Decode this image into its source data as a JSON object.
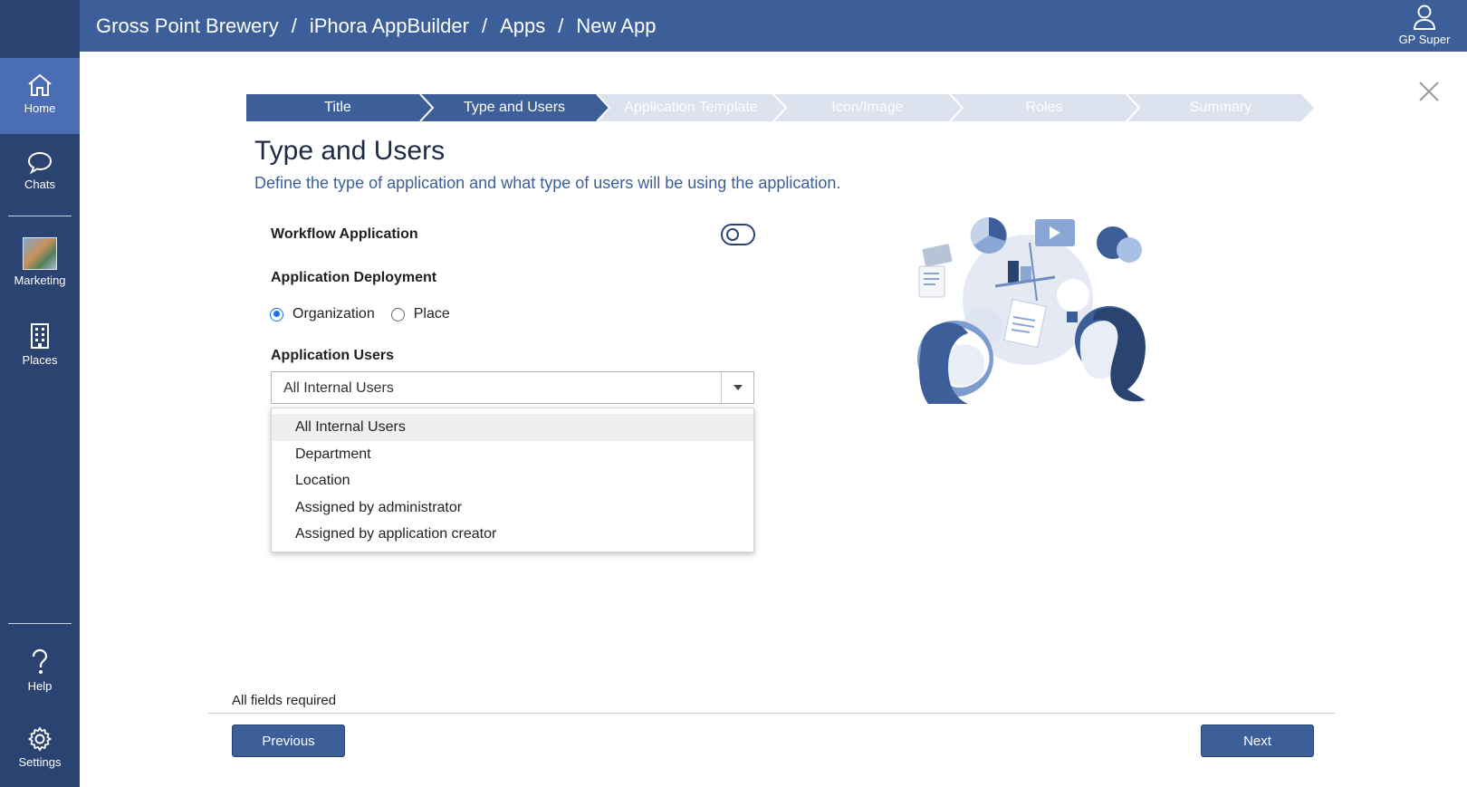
{
  "header": {
    "breadcrumb": [
      "Gross Point Brewery",
      "iPhora AppBuilder",
      "Apps",
      "New App"
    ],
    "breadcrumb_separator": "/",
    "user_name": "GP Super"
  },
  "sidebar": {
    "items": [
      {
        "label": "Home",
        "icon": "home-icon",
        "active": true
      },
      {
        "label": "Chats",
        "icon": "chat-icon"
      },
      {
        "label": "Marketing",
        "icon": "marketing-thumbnail"
      },
      {
        "label": "Places",
        "icon": "building-icon"
      },
      {
        "label": "Help",
        "icon": "help-icon"
      },
      {
        "label": "Settings",
        "icon": "gear-icon"
      }
    ]
  },
  "stepper": {
    "steps": [
      "Title",
      "Type and Users",
      "Application Template",
      "Icon/Image",
      "Roles",
      "Summary"
    ],
    "current_index": 1
  },
  "page": {
    "title": "Type and Users",
    "subtitle": "Define the type of application and what type of users will be using the application."
  },
  "form": {
    "workflow_label": "Workflow Application",
    "workflow_enabled": false,
    "deployment_label": "Application Deployment",
    "deployment_options": [
      "Organization",
      "Place"
    ],
    "deployment_selected": "Organization",
    "users_label": "Application Users",
    "users_selected": "All Internal Users",
    "users_options": [
      "All Internal Users",
      "Department",
      "Location",
      "Assigned by administrator",
      "Assigned by application creator"
    ]
  },
  "footer": {
    "required_note": "All fields required",
    "previous_label": "Previous",
    "next_label": "Next"
  },
  "colors": {
    "sidebar_bg": "#2b4370",
    "header_bg": "#3c5f99",
    "active_nav": "#4a6db3",
    "step_done": "#3c5f99",
    "step_todo": "#dde3ee",
    "accent_radio": "#1a73e8"
  }
}
